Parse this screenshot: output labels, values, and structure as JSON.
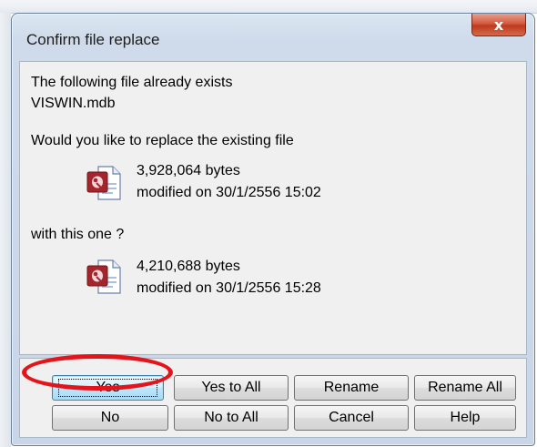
{
  "background": {
    "partial_text_left": "",
    "partial_text_right": ""
  },
  "dialog": {
    "title": "Confirm file replace",
    "close_symbol": "x",
    "message_line1": "The following file already exists",
    "filename": "VISWIN.mdb",
    "question": "Would you like to replace the existing file",
    "existing": {
      "size": "3,928,064 bytes",
      "modified": "modified on 30/1/2556 15:02",
      "icon": "access-database-file-icon"
    },
    "with_label": "with this one ?",
    "replacement": {
      "size": "4,210,688 bytes",
      "modified": "modified on 30/1/2556 15:28",
      "icon": "access-database-file-icon"
    }
  },
  "buttons": {
    "yes": "Yes",
    "yes_to_all": "Yes to All",
    "rename": "Rename",
    "rename_all": "Rename All",
    "no": "No",
    "no_to_all": "No to All",
    "cancel": "Cancel",
    "help": "Help"
  },
  "colors": {
    "annotation_circle": "#e3151b",
    "close_button": "#c0391f"
  }
}
